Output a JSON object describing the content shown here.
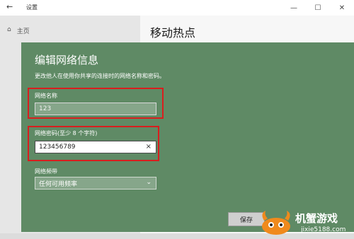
{
  "window": {
    "app_title": "设置",
    "back_icon": "←",
    "minimize": "—",
    "maximize": "☐",
    "close": "✕"
  },
  "left_pane": {
    "home_icon": "⌂",
    "home_label": "主页"
  },
  "right_pane": {
    "page_title": "移动热点"
  },
  "dialog": {
    "title": "编辑网络信息",
    "description": "更改他人在使用你共享的连接时的网络名称和密码。",
    "name_label": "网络名称",
    "name_value": "123",
    "password_label": "网络密码(至少 8 个字符)",
    "password_value": "123456789",
    "clear_icon": "×",
    "band_label": "网络频带",
    "band_value": "任何可用频率",
    "chevron": "⌄",
    "save_label": "保存"
  },
  "watermark": {
    "brand": "机蟹游戏",
    "site": "jixie5188.com"
  },
  "colors": {
    "dialog_bg": "#5f8a65",
    "highlight": "#d91e1e",
    "watermark_orange": "#f08a1c"
  }
}
